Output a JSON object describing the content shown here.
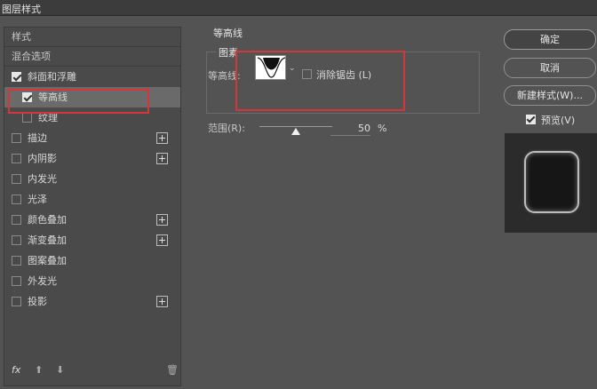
{
  "window": {
    "title": "图层样式"
  },
  "left_panel": {
    "header": "样式",
    "blend_options": "混合选项",
    "items": [
      {
        "label": "斜面和浮雕",
        "checked": true,
        "has_add": false,
        "sub": false,
        "active": false
      },
      {
        "label": "等高线",
        "checked": true,
        "has_add": false,
        "sub": true,
        "active": true
      },
      {
        "label": "纹理",
        "checked": false,
        "has_add": false,
        "sub": true,
        "active": false
      },
      {
        "label": "描边",
        "checked": false,
        "has_add": true,
        "sub": false,
        "active": false
      },
      {
        "label": "内阴影",
        "checked": false,
        "has_add": true,
        "sub": false,
        "active": false
      },
      {
        "label": "内发光",
        "checked": false,
        "has_add": false,
        "sub": false,
        "active": false
      },
      {
        "label": "光泽",
        "checked": false,
        "has_add": false,
        "sub": false,
        "active": false
      },
      {
        "label": "颜色叠加",
        "checked": false,
        "has_add": true,
        "sub": false,
        "active": false
      },
      {
        "label": "渐变叠加",
        "checked": false,
        "has_add": true,
        "sub": false,
        "active": false
      },
      {
        "label": "图案叠加",
        "checked": false,
        "has_add": false,
        "sub": false,
        "active": false
      },
      {
        "label": "外发光",
        "checked": false,
        "has_add": false,
        "sub": false,
        "active": false
      },
      {
        "label": "投影",
        "checked": false,
        "has_add": true,
        "sub": false,
        "active": false
      }
    ],
    "footer": {
      "fx": "fx",
      "up": "⬆",
      "down": "⬇",
      "trash": "🗑"
    }
  },
  "contour_panel": {
    "section_title": "等高线",
    "group_title": "图素",
    "contour_label": "等高线:",
    "antialias_label": "消除锯齿 (L)",
    "antialias_checked": false,
    "range_label": "范围(R):",
    "range_value": "50",
    "range_unit": "%",
    "range_fraction": 0.5
  },
  "buttons": {
    "ok": "确定",
    "cancel": "取消",
    "new_style": "新建样式(W)...",
    "preview": "预览(V)",
    "preview_checked": true
  },
  "colors": {
    "highlight": "#d6363a",
    "panel": "#535353"
  }
}
